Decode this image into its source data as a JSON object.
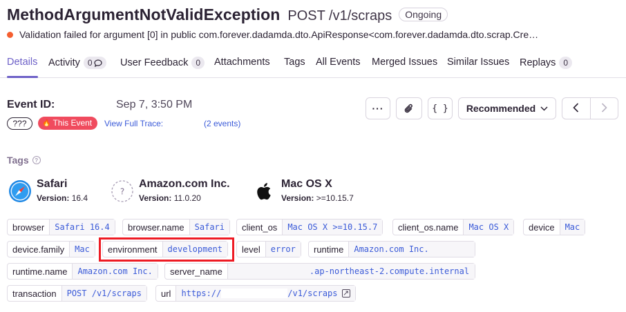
{
  "header": {
    "title": "MethodArgumentNotValidException",
    "subtitle": "POST /v1/scraps",
    "status_badge": "Ongoing",
    "error_message": "Validation failed for argument [0] in public com.forever.dadamda.dto.ApiResponse<com.forever.dadamda.dto.scrap.Cre…"
  },
  "tabs": [
    {
      "label": "Details",
      "active": true
    },
    {
      "label": "Activity",
      "count": "0"
    },
    {
      "label": "User Feedback",
      "count": "0"
    },
    {
      "label": "Attachments"
    },
    {
      "label": "Tags"
    },
    {
      "label": "All Events"
    },
    {
      "label": "Merged Issues"
    },
    {
      "label": "Similar Issues"
    },
    {
      "label": "Replays",
      "count": "0"
    }
  ],
  "event": {
    "id_label": "Event ID:",
    "date": "Sep 7, 3:50 PM",
    "unknown_badge": "???",
    "this_event": "This Event",
    "view_trace": "View Full Trace:",
    "trace_count": "(2 events)"
  },
  "toolbar": {
    "more": "···",
    "json": "{ }",
    "recommended": "Recommended",
    "prev": "‹",
    "next": "›"
  },
  "tags": {
    "title": "Tags",
    "context": [
      {
        "name": "Safari",
        "version_label": "Version:",
        "version": "16.4",
        "icon": "safari-icon"
      },
      {
        "name": "Amazon.com Inc.",
        "version_label": "Version:",
        "version": "11.0.20",
        "icon": "unknown-runtime-icon"
      },
      {
        "name": "Mac OS X",
        "version_label": "Version:",
        "version": ">=10.15.7",
        "icon": "apple-icon"
      }
    ],
    "pills": [
      {
        "key": "browser",
        "value": "Safari 16.4"
      },
      {
        "key": "browser.name",
        "value": "Safari"
      },
      {
        "key": "client_os",
        "value": "Mac OS X >=10.15.7"
      },
      {
        "key": "client_os.name",
        "value": "Mac OS X"
      },
      {
        "key": "device",
        "value": "Mac"
      },
      {
        "key": "device.family",
        "value": "Mac"
      },
      {
        "key": "environment",
        "value": "development"
      },
      {
        "key": "level",
        "value": "error"
      },
      {
        "key": "runtime",
        "value": "Amazon.com Inc."
      },
      {
        "key": "runtime.name",
        "value": "Amazon.com Inc."
      },
      {
        "key": "server_name",
        "value": ".ap-northeast-2.compute.internal"
      },
      {
        "key": "transaction",
        "value": "POST /v1/scraps"
      },
      {
        "key": "url",
        "value": "https://",
        "value_tail": "/v1/scraps"
      }
    ]
  },
  "colors": {
    "accent": "#6c5fc7",
    "link": "#3a5ad8",
    "error_dot": "#f55f30",
    "this_event": "#f04b5e",
    "highlight": "#ee1b24"
  }
}
